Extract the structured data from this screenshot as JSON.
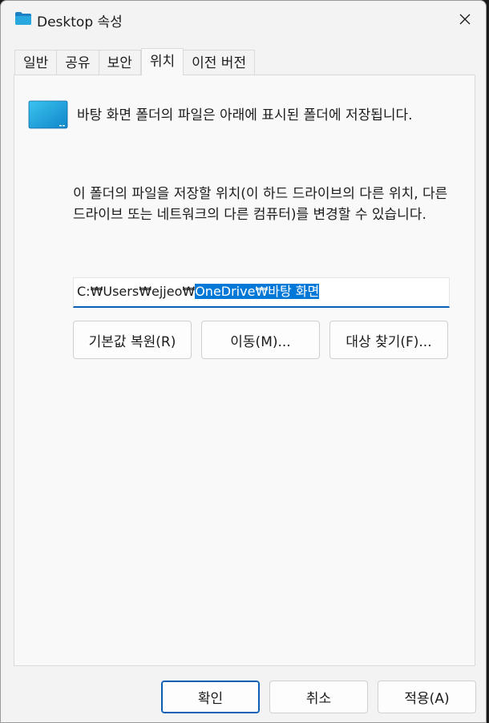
{
  "window": {
    "title": "Desktop 속성"
  },
  "tabs": [
    {
      "label": "일반",
      "active": false
    },
    {
      "label": "공유",
      "active": false
    },
    {
      "label": "보안",
      "active": false
    },
    {
      "label": "위치",
      "active": true
    },
    {
      "label": "이전 버전",
      "active": false
    }
  ],
  "location": {
    "description": "바탕 화면 폴더의 파일은 아래에 표시된 폴더에 저장됩니다.",
    "info": "이 폴더의 파일을 저장할 위치(이 하드 드라이브의 다른 위치, 다른 드라이브 또는 네트워크의 다른 컴퓨터)를 변경할 수 있습니다.",
    "path_prefix": "C:₩Users₩ejjeo₩",
    "path_selected": "OneDrive₩바탕 화면",
    "restore_label": "기본값 복원(R)",
    "move_label": "이동(M)...",
    "find_target_label": "대상 찾기(F)..."
  },
  "footer": {
    "ok_label": "확인",
    "cancel_label": "취소",
    "apply_label": "적용(A)"
  },
  "colors": {
    "accent": "#0a5fb4",
    "selection": "#0078d7",
    "folder": "#1aa0d8"
  }
}
